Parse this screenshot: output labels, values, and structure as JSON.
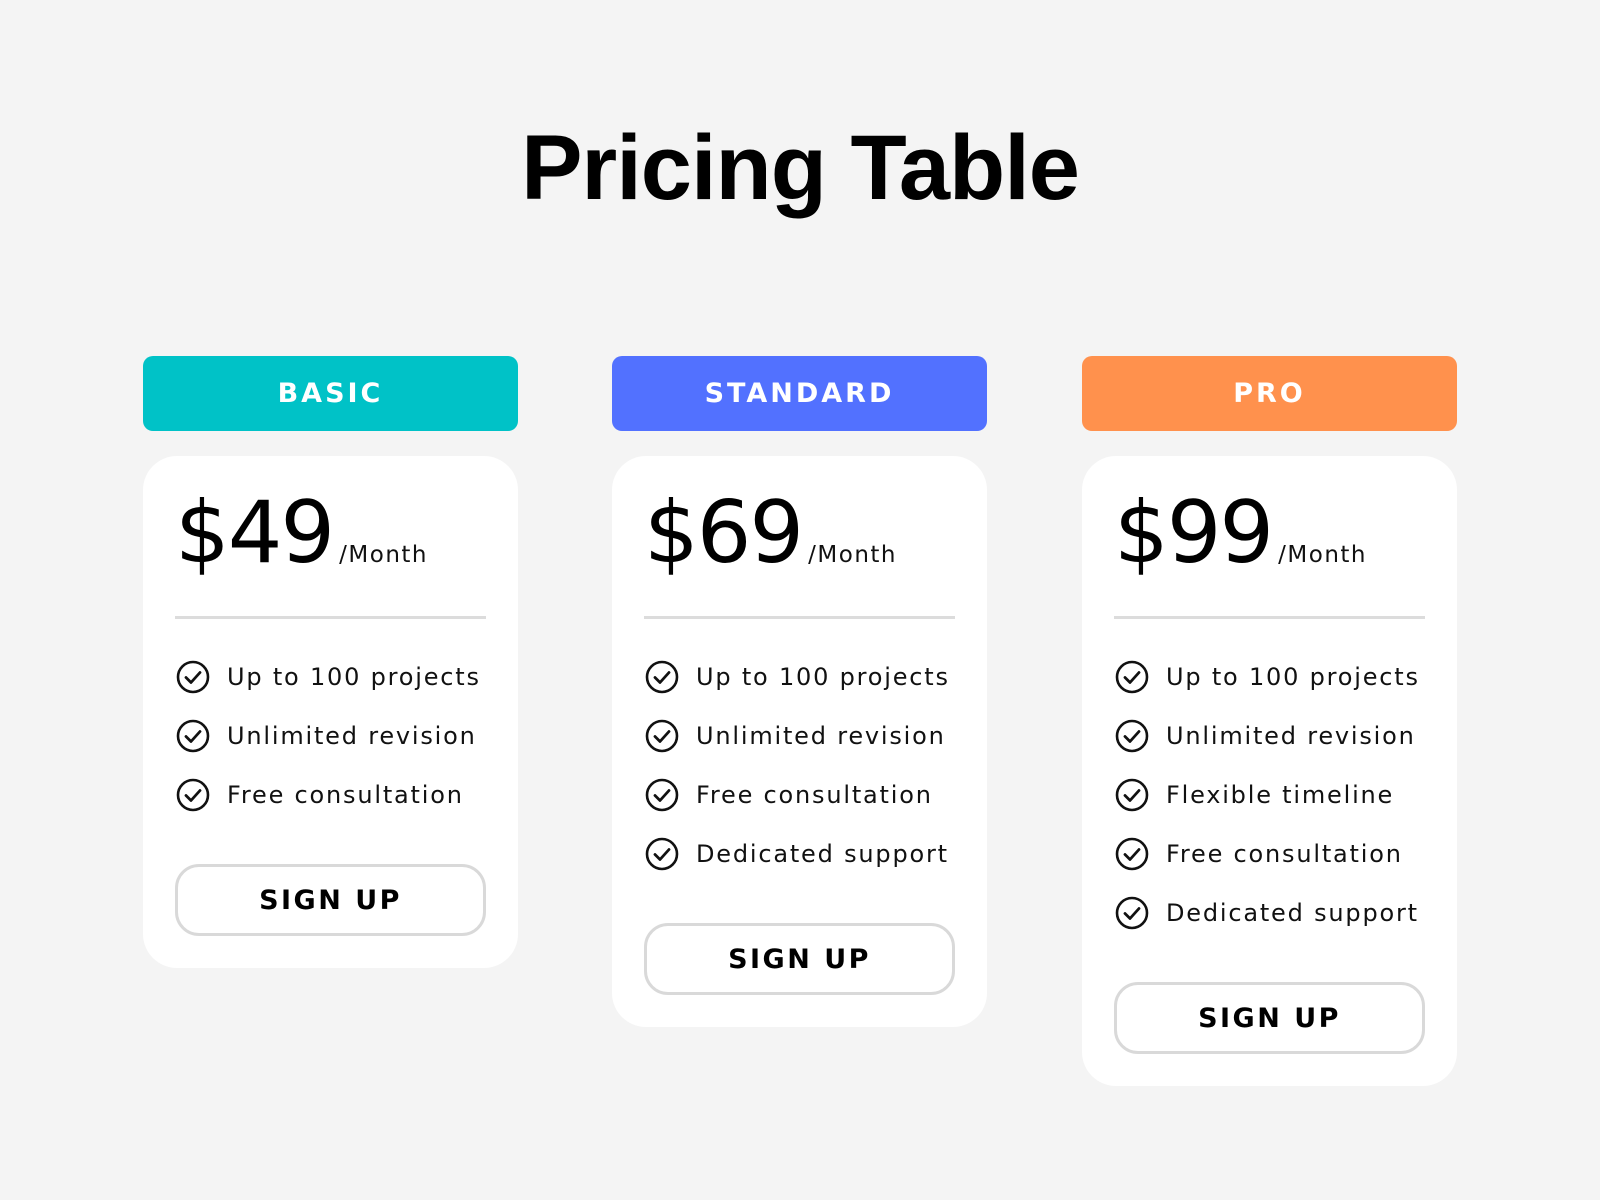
{
  "page": {
    "title": "Pricing Table",
    "background_color": "#f4f4f4"
  },
  "plans": [
    {
      "name": "BASIC",
      "color": "#00c2c7",
      "price": "$49",
      "period": "/Month",
      "features": [
        "Up to 100 projects",
        "Unlimited revision",
        "Free consultation"
      ],
      "cta": "SIGN UP",
      "check_icon": "check-circle-icon"
    },
    {
      "name": "STANDARD",
      "color": "#5271ff",
      "price": "$69",
      "period": "/Month",
      "features": [
        "Up to 100 projects",
        "Unlimited revision",
        "Free consultation",
        "Dedicated support"
      ],
      "cta": "SIGN UP",
      "check_icon": "check-circle-icon"
    },
    {
      "name": "PRO",
      "color": "#ff914d",
      "price": "$99",
      "period": "/Month",
      "features": [
        "Up to 100 projects",
        "Unlimited revision",
        "Flexible timeline",
        "Free consultation",
        "Dedicated support"
      ],
      "cta": "SIGN UP",
      "check_icon": "check-circle-icon"
    }
  ]
}
